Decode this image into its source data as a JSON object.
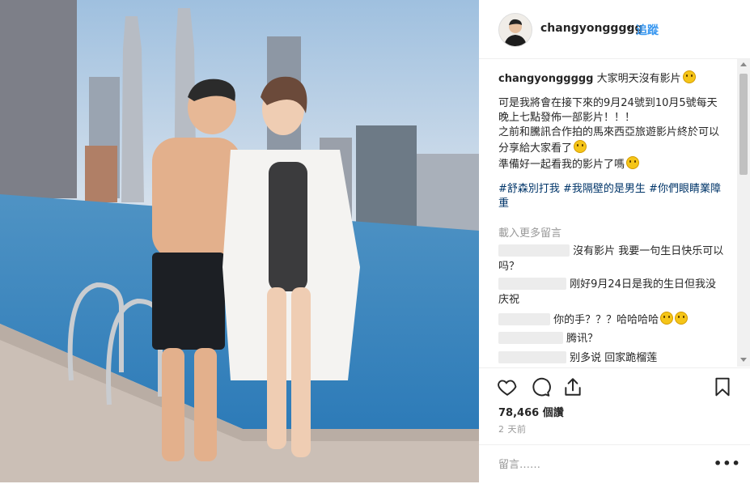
{
  "post": {
    "username": "changyonggggg",
    "separator": "•",
    "follow_label": "追蹤"
  },
  "caption": {
    "username": "changyonggggg",
    "line1": "大家明天沒有影片",
    "para2_line1": "可是我將會在接下來的9月24號到10月5號每天晚上七點發佈一部影片！！！",
    "para2_line2": "之前和騰訊合作拍的馬來西亞旅遊影片終於可以分享給大家看了",
    "para2_line3": "準備好一起看我的影片了嗎",
    "hashtags": "#舒森別打我 #我隔壁的是男生 #你們眼睛業障重"
  },
  "load_more_label": "載入更多留言",
  "comments": [
    {
      "text": "沒有影片 我要一句生日快乐可以吗？"
    },
    {
      "text": "刚好9月24日是我的生日但我没庆祝"
    },
    {
      "text": "你的手？？？哈哈哈哈"
    },
    {
      "text": "腾讯？"
    },
    {
      "text": "别多说 回家跪榴莲"
    }
  ],
  "likes_label": "78,466 個讚",
  "time_label": "2 天前",
  "add_comment_placeholder": "留言……",
  "more_options_label": "•••",
  "icons": {
    "like": "heart-icon",
    "comment": "comment-bubble-icon",
    "share": "share-icon",
    "save": "bookmark-icon",
    "scroll_up": "scroll-up-arrow",
    "scroll_down": "scroll-down-arrow"
  },
  "colors": {
    "link": "#3897f0",
    "hashtag": "#003569",
    "muted": "#999999",
    "text": "#262626"
  }
}
